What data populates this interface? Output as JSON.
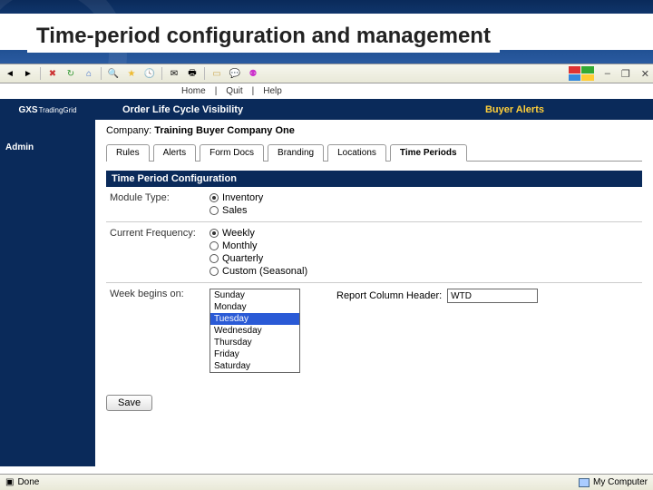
{
  "slide": {
    "title": "Time-period configuration and management"
  },
  "topbar": {
    "home": "Home",
    "quit": "Quit",
    "help": "Help"
  },
  "brand": {
    "name": "GXS",
    "sub": "TradingGrid"
  },
  "header": {
    "module": "Order Life Cycle Visibility",
    "right": "Buyer Alerts"
  },
  "sidebar": {
    "admin": "Admin"
  },
  "company": {
    "label": "Company:",
    "name": "Training Buyer Company One"
  },
  "tabs": {
    "list": [
      {
        "label": "Rules"
      },
      {
        "label": "Alerts"
      },
      {
        "label": "Form Docs"
      },
      {
        "label": "Branding"
      },
      {
        "label": "Locations"
      },
      {
        "label": "Time Periods"
      }
    ],
    "active": 5
  },
  "section": {
    "title": "Time Period Configuration"
  },
  "moduleType": {
    "label": "Module Type:",
    "options": [
      {
        "label": "Inventory",
        "selected": true
      },
      {
        "label": "Sales",
        "selected": false
      }
    ]
  },
  "frequency": {
    "label": "Current Frequency:",
    "options": [
      {
        "label": "Weekly",
        "selected": true
      },
      {
        "label": "Monthly",
        "selected": false
      },
      {
        "label": "Quarterly",
        "selected": false
      },
      {
        "label": "Custom (Seasonal)",
        "selected": false
      }
    ]
  },
  "weekBegins": {
    "label": "Week begins on:",
    "days": [
      "Sunday",
      "Monday",
      "Tuesday",
      "Wednesday",
      "Thursday",
      "Friday",
      "Saturday"
    ],
    "selected": 2
  },
  "reportHeader": {
    "label": "Report Column Header:",
    "value": "WTD"
  },
  "buttons": {
    "save": "Save"
  },
  "status": {
    "left": "Done",
    "right": "My Computer"
  }
}
